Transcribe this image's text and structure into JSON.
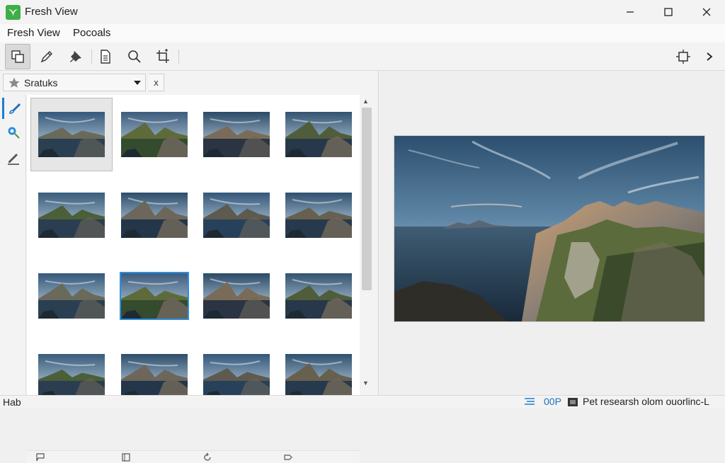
{
  "window": {
    "title": "Fresh View"
  },
  "menu": {
    "items": [
      "Fresh View",
      "Pocoals"
    ]
  },
  "toolbar": {
    "tools": [
      "copy-icon",
      "pen-icon",
      "pin-icon",
      "document-icon",
      "search-icon",
      "crop-icon"
    ],
    "right_tools": [
      "fit-frame-icon",
      "chevron-right-icon"
    ]
  },
  "filter": {
    "label": "Sratuks",
    "close": "x"
  },
  "side_tools": [
    "brush-icon",
    "adjust-icon",
    "pencil-icon"
  ],
  "thumbnails": [
    {
      "variant": "cliff-sunset",
      "selected": true
    },
    {
      "variant": "meadow-sunrise"
    },
    {
      "variant": "river-clouds"
    },
    {
      "variant": "lake-dusk"
    },
    {
      "variant": "lake-valley"
    },
    {
      "variant": "mountain-reflection"
    },
    {
      "variant": "blue-mountains"
    },
    {
      "variant": "lake-cliffs"
    },
    {
      "variant": "sea-cliff"
    },
    {
      "variant": "twilight-lake",
      "focused": true
    },
    {
      "variant": "sunburst-cliff"
    },
    {
      "variant": "coast-rocks"
    },
    {
      "variant": "cliff-bay"
    },
    {
      "variant": "golden-hill"
    },
    {
      "variant": "peak-sky"
    },
    {
      "variant": "evening-lake"
    }
  ],
  "status": {
    "left": "Hab",
    "code": "00P",
    "message": "Pet researsh olom ouorlinc-L"
  }
}
